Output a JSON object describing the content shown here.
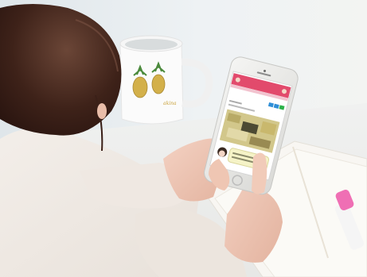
{
  "scene": {
    "mug_text": "akina",
    "phone_screen": {
      "title": "",
      "header_colors": [
        "#e24a6c",
        "#f2c3cf"
      ],
      "button_colors": [
        "#2f8fd7",
        "#2f8fd7",
        "#2db24a"
      ],
      "map_color": "#d2c78b",
      "bubble_color": "#f5f3c7"
    }
  }
}
